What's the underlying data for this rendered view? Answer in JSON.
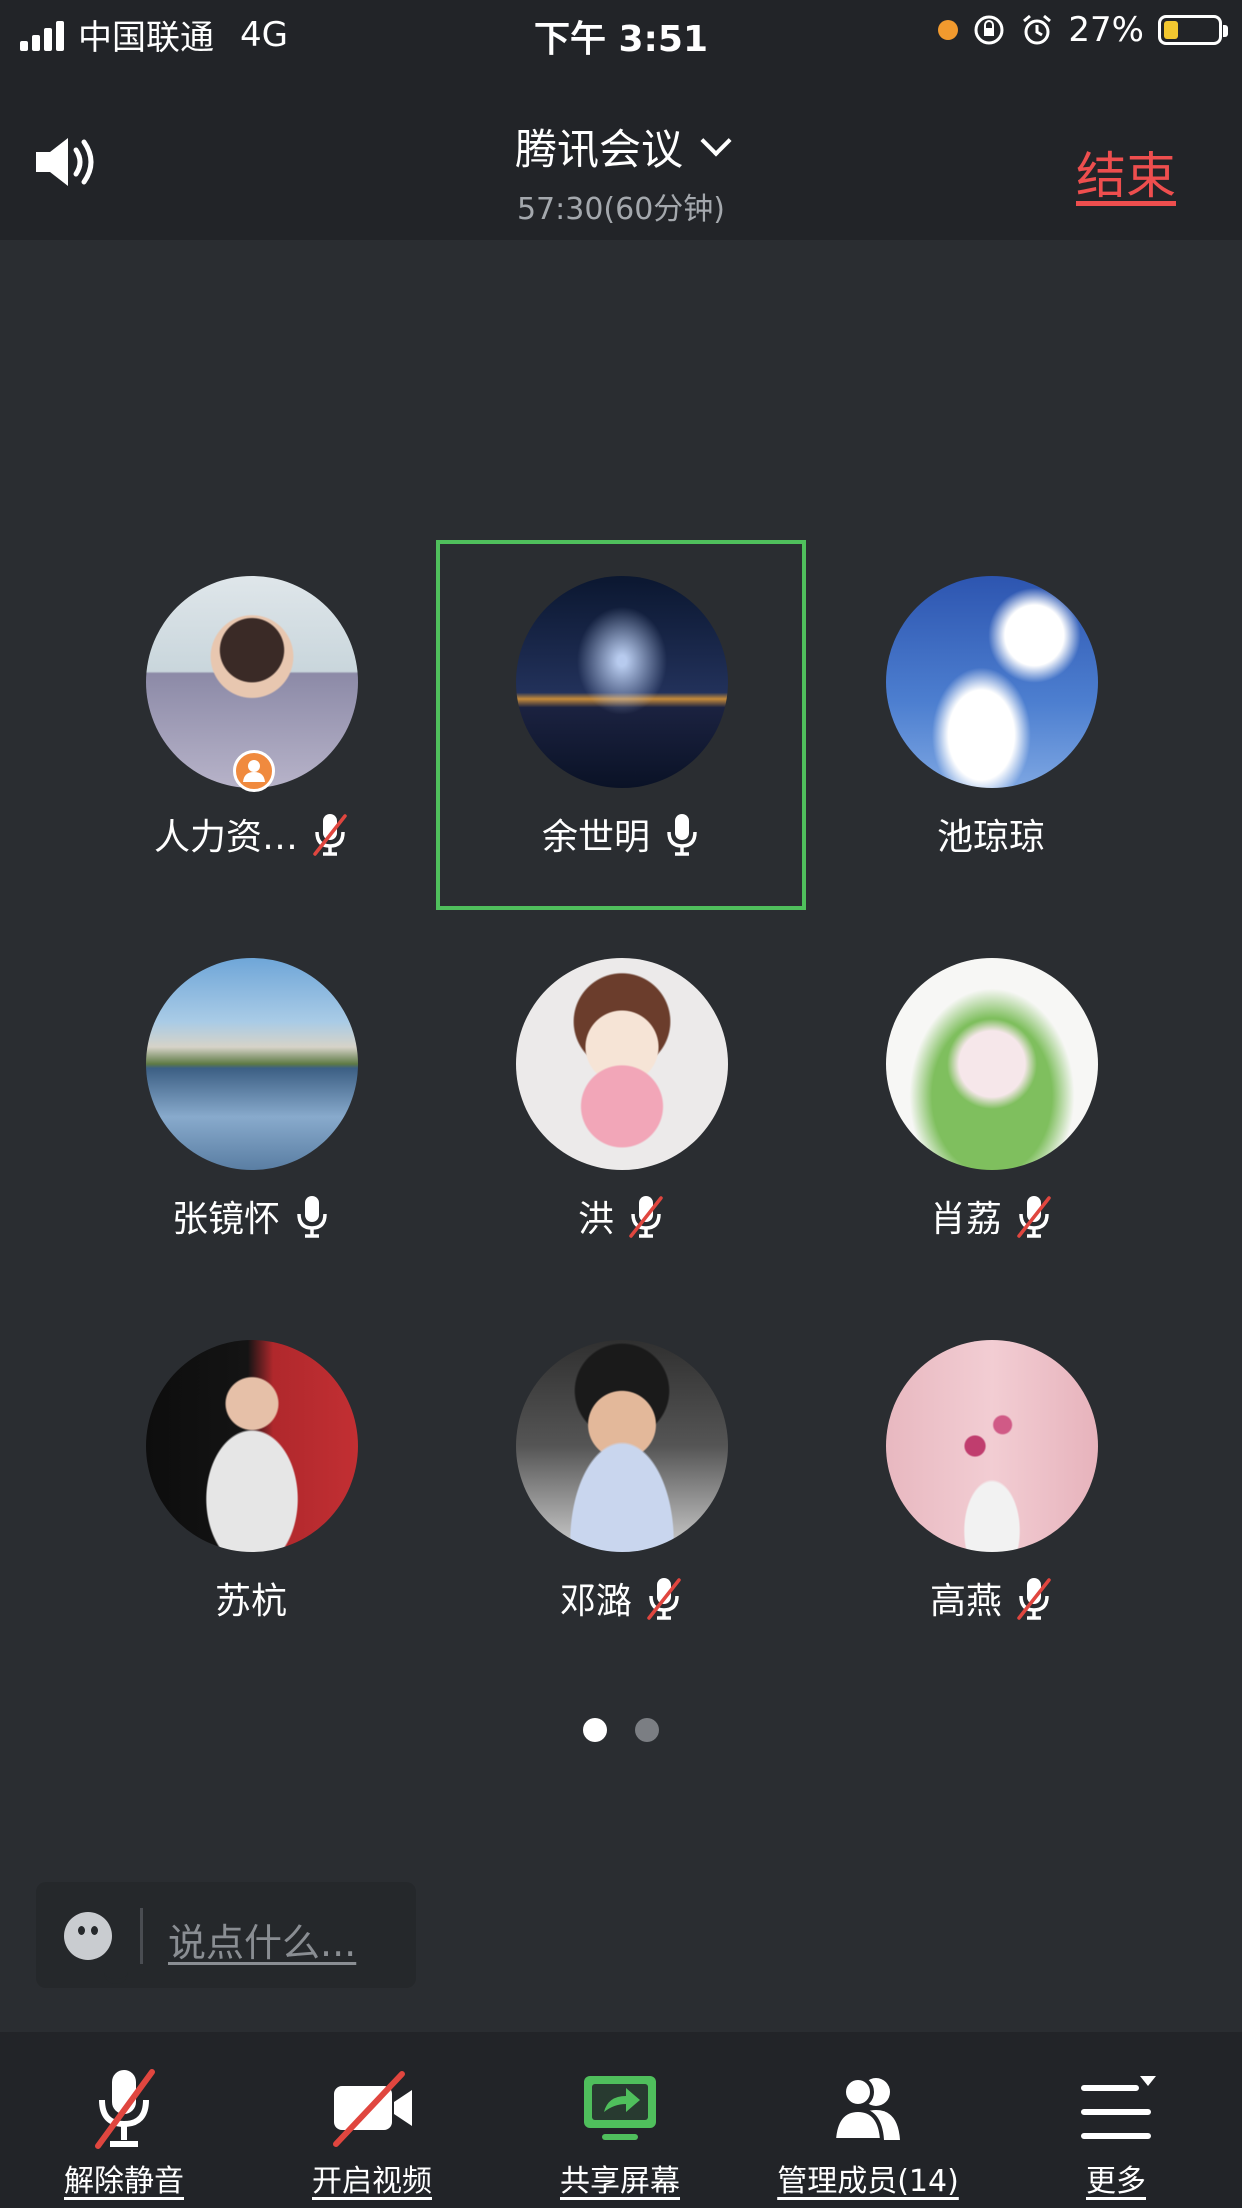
{
  "status_bar": {
    "carrier": "中国联通",
    "network": "4G",
    "time": "下午 3:51",
    "battery_text": "27%",
    "battery_level": 0.27
  },
  "header": {
    "title": "腾讯会议",
    "subtitle": "57:30(60分钟)",
    "end_label": "结束"
  },
  "participants": [
    {
      "name": "人力资…",
      "mic": "muted",
      "host": true,
      "avatar": "photo-woman"
    },
    {
      "name": "余世明",
      "mic": "on",
      "active": true,
      "avatar": "night-bridge"
    },
    {
      "name": "池琼琼",
      "mic": "none",
      "avatar": "blue-sky-clouds"
    },
    {
      "name": "张镜怀",
      "mic": "on",
      "avatar": "lake-reflection"
    },
    {
      "name": "洪",
      "mic": "muted",
      "avatar": "cartoon-girl"
    },
    {
      "name": "肖荔",
      "mic": "muted",
      "avatar": "illustration-lying"
    },
    {
      "name": "苏杭",
      "mic": "none",
      "avatar": "man-red-bg"
    },
    {
      "name": "邓潞",
      "mic": "muted",
      "avatar": "man-portrait"
    },
    {
      "name": "高燕",
      "mic": "muted",
      "avatar": "pink-flowers"
    }
  ],
  "pager": {
    "pages": 2,
    "current": 1
  },
  "chat": {
    "placeholder": "说点什么..."
  },
  "toolbar": {
    "unmute": "解除静音",
    "video": "开启视频",
    "share": "共享屏幕",
    "members": "管理成员(14)",
    "more": "更多"
  },
  "colors": {
    "end": "#ee4e4e",
    "active_border": "#4fbf5c",
    "share_icon": "#4fbf5c"
  }
}
